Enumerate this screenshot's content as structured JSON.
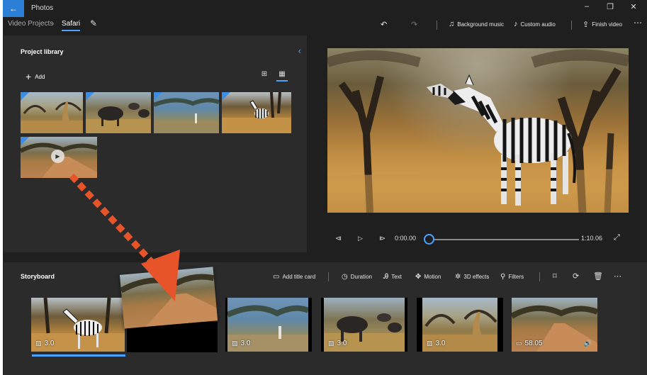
{
  "titlebar": {
    "app_title": "Photos",
    "back_icon": "arrow-left-icon",
    "controls": {
      "minimize": "–",
      "restore": "❐",
      "close": "✕"
    }
  },
  "breadcrumb": {
    "root": "Video Projects",
    "separator": "›",
    "current": "Safari"
  },
  "commands": {
    "undo": "↶",
    "redo": "↷",
    "background_music": "Background music",
    "custom_audio": "Custom audio",
    "finish_video": "Finish video",
    "more": "⋯"
  },
  "library": {
    "title": "Project library",
    "add_label": "Add",
    "collapse_icon": "chevron-left-icon",
    "views": [
      "grid-large-icon",
      "grid-small-icon"
    ],
    "items": [
      {
        "scene": "giraffe"
      },
      {
        "scene": "wildebeest"
      },
      {
        "scene": "acacia-blue"
      },
      {
        "scene": "zebra"
      },
      {
        "scene": "road",
        "is_video": true
      }
    ]
  },
  "player": {
    "current_time": "0:00.00",
    "total_time": "1:10.06",
    "progress": 0.0
  },
  "storyboard": {
    "title": "Storyboard",
    "tools": {
      "add_title_card": "Add title card",
      "duration": "Duration",
      "text": "Text",
      "motion": "Motion",
      "effects_3d": "3D effects",
      "filters": "Filters"
    },
    "clips": [
      {
        "scene": "zebra",
        "duration": "3.0",
        "type": "image",
        "selected": true
      },
      {
        "scene": "acacia-blue",
        "duration": "3.0",
        "type": "image"
      },
      {
        "scene": "wildebeest",
        "duration": "3.0",
        "type": "image"
      },
      {
        "scene": "giraffe",
        "duration": "3.0",
        "type": "image"
      },
      {
        "scene": "road",
        "duration": "58.05",
        "type": "video",
        "has_audio": true
      }
    ]
  },
  "colors": {
    "accent": "#4aa3ff",
    "drag_arrow": "#e8542a",
    "panel_bg": "#2b2b2b",
    "app_bg": "#1f1f1f"
  }
}
